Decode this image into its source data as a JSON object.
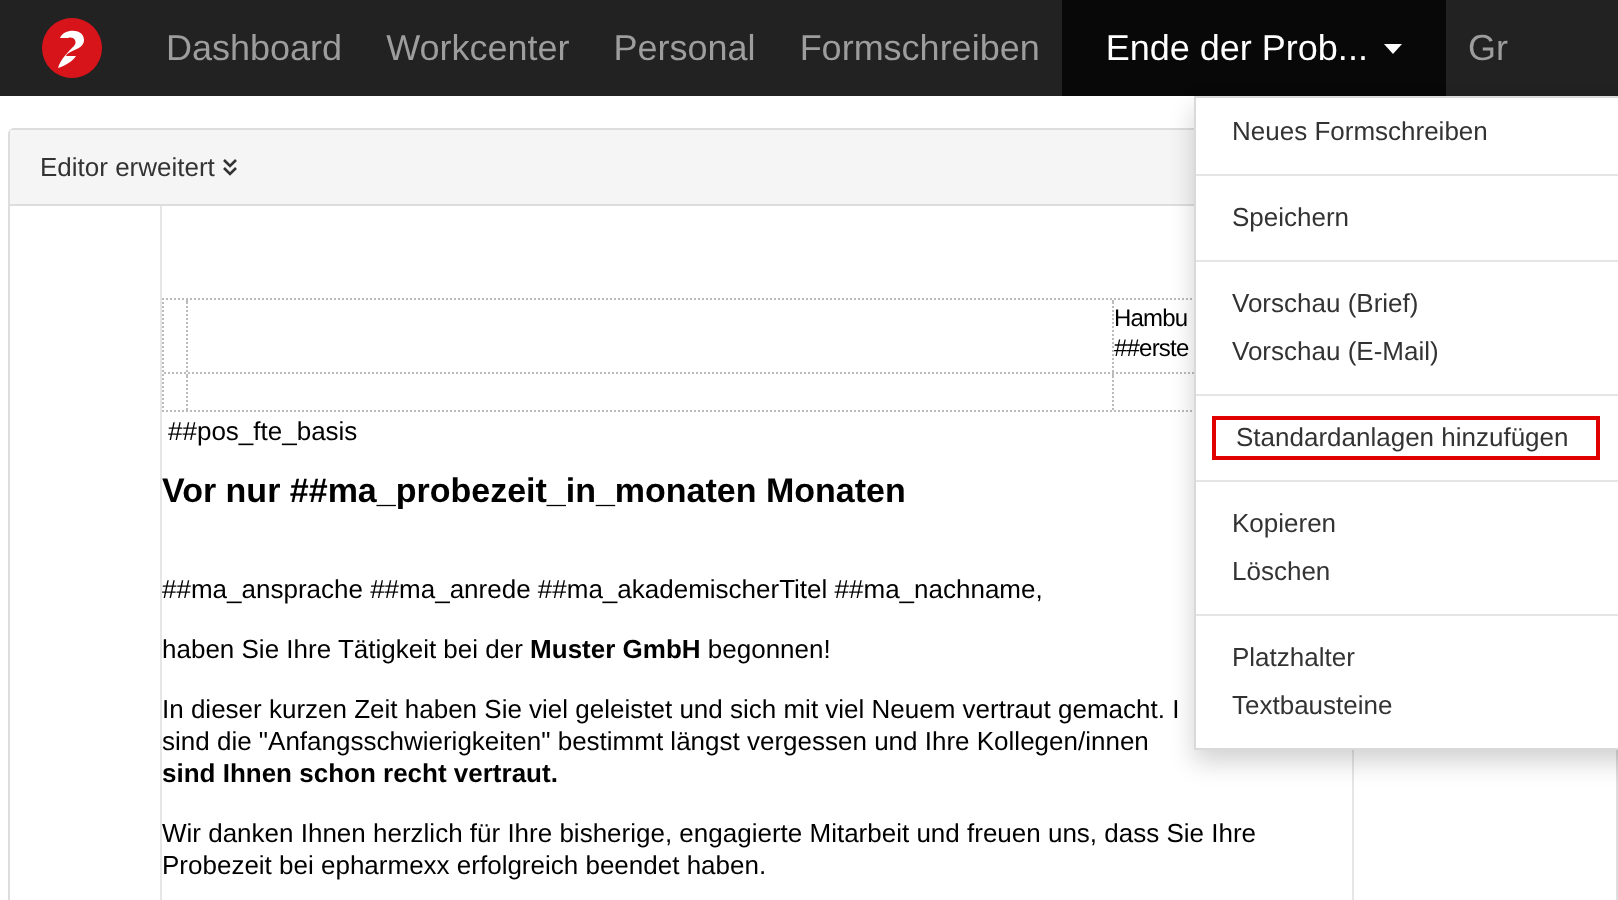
{
  "navbar": {
    "items": [
      {
        "label": "Dashboard",
        "selected": false
      },
      {
        "label": "Workcenter",
        "selected": false
      },
      {
        "label": "Personal",
        "selected": false
      },
      {
        "label": "Formschreiben",
        "selected": false
      },
      {
        "label": "Ende der Prob...",
        "selected": true,
        "kind": "dropdown"
      },
      {
        "label": "Gr",
        "selected": false
      }
    ]
  },
  "editor": {
    "toolbar_label": "Editor erweitert",
    "table_cell_lines": [
      "Hambu",
      "##erste"
    ],
    "placeholder_line": "##pos_fte_basis",
    "heading": "Vor nur ##ma_probezeit_in_monaten Monaten",
    "paragraphs": [
      [
        "##ma_ansprache ##ma_anrede ##ma_akademischerTitel ##ma_nachname,"
      ],
      [
        "haben Sie Ihre Tätigkeit bei der **Muster GmbH** begonnen!"
      ],
      [
        "In dieser kurzen Zeit haben Sie viel geleistet und sich mit viel Neuem vertraut gemacht. I",
        "sind die \"Anfangsschwierigkeiten\" bestimmt längst vergessen und Ihre Kollegen/innen",
        "**sind Ihnen schon recht vertraut.**"
      ],
      [
        "Wir danken Ihnen herzlich für Ihre bisherige, engagierte Mitarbeit und freuen uns, dass Sie Ihre",
        "Probezeit bei epharmexx erfolgreich beendet haben."
      ]
    ]
  },
  "dropdown_menu": {
    "groups": [
      [
        {
          "label": "Neues Formschreiben",
          "highlighted": false
        }
      ],
      [
        {
          "label": "Speichern",
          "highlighted": false
        }
      ],
      [
        {
          "label": "Vorschau (Brief)",
          "highlighted": false
        },
        {
          "label": "Vorschau (E-Mail)",
          "highlighted": false
        }
      ],
      [
        {
          "label": "Standardanlagen hinzufügen",
          "highlighted": true
        }
      ],
      [
        {
          "label": "Kopieren",
          "highlighted": false
        },
        {
          "label": "Löschen",
          "highlighted": false
        }
      ],
      [
        {
          "label": "Platzhalter",
          "highlighted": false
        },
        {
          "label": "Textbausteine",
          "highlighted": false
        }
      ]
    ]
  }
}
